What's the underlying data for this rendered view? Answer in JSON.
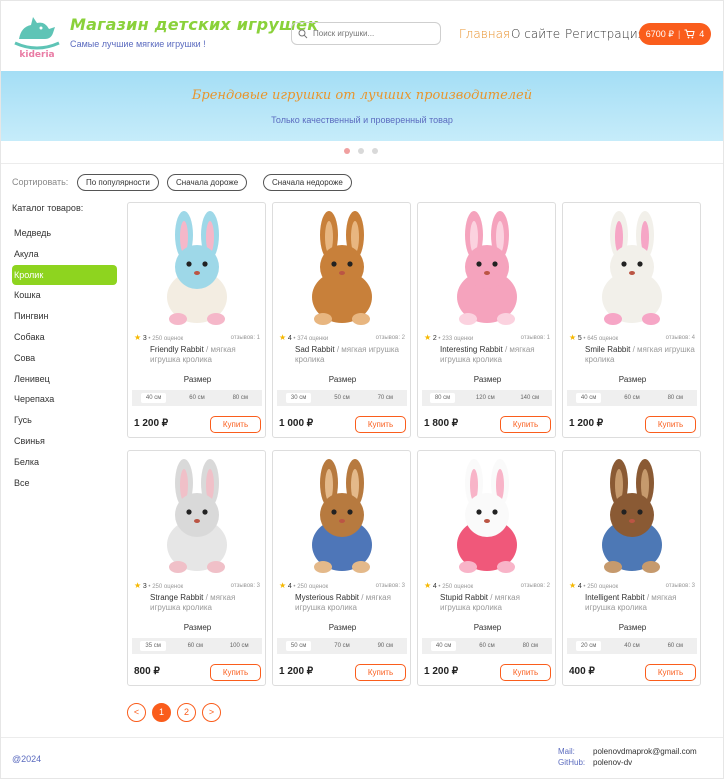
{
  "header": {
    "title": "Магазин детских игрушек",
    "subtitle": "Самые лучшие мягкие игрушки !",
    "logo_text": "kideria",
    "search_placeholder": "Поиск игрушки...",
    "nav": [
      "Главная",
      "О сайте",
      "Регистрация"
    ],
    "cart_total": "6700 ₽",
    "cart_count": "4",
    "accent": "#fa5d1c",
    "brand_green": "#8ad13a"
  },
  "banner": {
    "title": "Брендовые игрушки от лучших производителей",
    "subtitle": "Только качественный и проверенный товар"
  },
  "sort": {
    "label": "Сортировать:",
    "options": [
      "По популярности",
      "Сначала дороже",
      "Сначала недороже"
    ]
  },
  "catalog": {
    "title": "Каталог товаров:",
    "items": [
      "Медведь",
      "Акула",
      "Кролик",
      "Кошка",
      "Пингвин",
      "Собака",
      "Сова",
      "Ленивец",
      "Черепаха",
      "Гусь",
      "Свинья",
      "Белка",
      "Все"
    ],
    "active": "Кролик"
  },
  "products": [
    {
      "rating": "3",
      "ratings": "• 250 оценок",
      "reviews": "отзывов: 1",
      "name": "Friendly Rabbit",
      "type": "мягкая игрушка кролика",
      "size_label": "Размер",
      "sizes": [
        "40 см",
        "60 см",
        "80 см"
      ],
      "price": "1 200 ₽",
      "buy": "Купить"
    },
    {
      "rating": "4",
      "ratings": "• 374 оценки",
      "reviews": "отзывов: 2",
      "name": "Sad Rabbit",
      "type": "мягкая игрушка кролика",
      "size_label": "Размер",
      "sizes": [
        "30 см",
        "50 см",
        "70 см"
      ],
      "price": "1 000 ₽",
      "buy": "Купить"
    },
    {
      "rating": "2",
      "ratings": "• 233 оценки",
      "reviews": "отзывов: 1",
      "name": "Interesting Rabbit",
      "type": "мягкая игрушка кролика",
      "size_label": "Размер",
      "sizes": [
        "80 см",
        "120 см",
        "140 см"
      ],
      "price": "1 800 ₽",
      "buy": "Купить"
    },
    {
      "rating": "5",
      "ratings": "• 645 оценок",
      "reviews": "отзывов: 4",
      "name": "Smile Rabbit",
      "type": "мягкая игрушка кролика",
      "size_label": "Размер",
      "sizes": [
        "40 см",
        "60 см",
        "80 см"
      ],
      "price": "1 200 ₽",
      "buy": "Купить"
    },
    {
      "rating": "3",
      "ratings": "• 250 оценок",
      "reviews": "отзывов: 3",
      "name": "Strange Rabbit",
      "type": "мягкая игрушка кролика",
      "size_label": "Размер",
      "sizes": [
        "35 см",
        "60 см",
        "100 см"
      ],
      "price": "800 ₽",
      "buy": "Купить"
    },
    {
      "rating": "4",
      "ratings": "• 250 оценок",
      "reviews": "отзывов: 3",
      "name": "Mysterious Rabbit",
      "type": "мягкая игрушка кролика",
      "size_label": "Размер",
      "sizes": [
        "50 см",
        "70 см",
        "90 см"
      ],
      "price": "1 200 ₽",
      "buy": "Купить"
    },
    {
      "rating": "4",
      "ratings": "• 250 оценок",
      "reviews": "отзывов: 2",
      "name": "Stupid Rabbit",
      "type": "мягкая игрушка кролика",
      "size_label": "Размер",
      "sizes": [
        "40 см",
        "60 см",
        "80 см"
      ],
      "price": "1 200 ₽",
      "buy": "Купить"
    },
    {
      "rating": "4",
      "ratings": "• 250 оценок",
      "reviews": "отзывов: 3",
      "name": "Intelligent Rabbit",
      "type": "мягкая игрушка кролика",
      "size_label": "Размер",
      "sizes": [
        "20 см",
        "40 см",
        "60 см"
      ],
      "price": "400 ₽",
      "buy": "Купить"
    }
  ],
  "pagination": {
    "prev": "<",
    "pages": [
      "1",
      "2"
    ],
    "next": ">",
    "current": "1"
  },
  "footer": {
    "copyright": "@2024",
    "mail_label": "Mail:",
    "mail": "polenovdmaprok@gmail.com",
    "github_label": "GitHub:",
    "github": "polenov-dv"
  }
}
